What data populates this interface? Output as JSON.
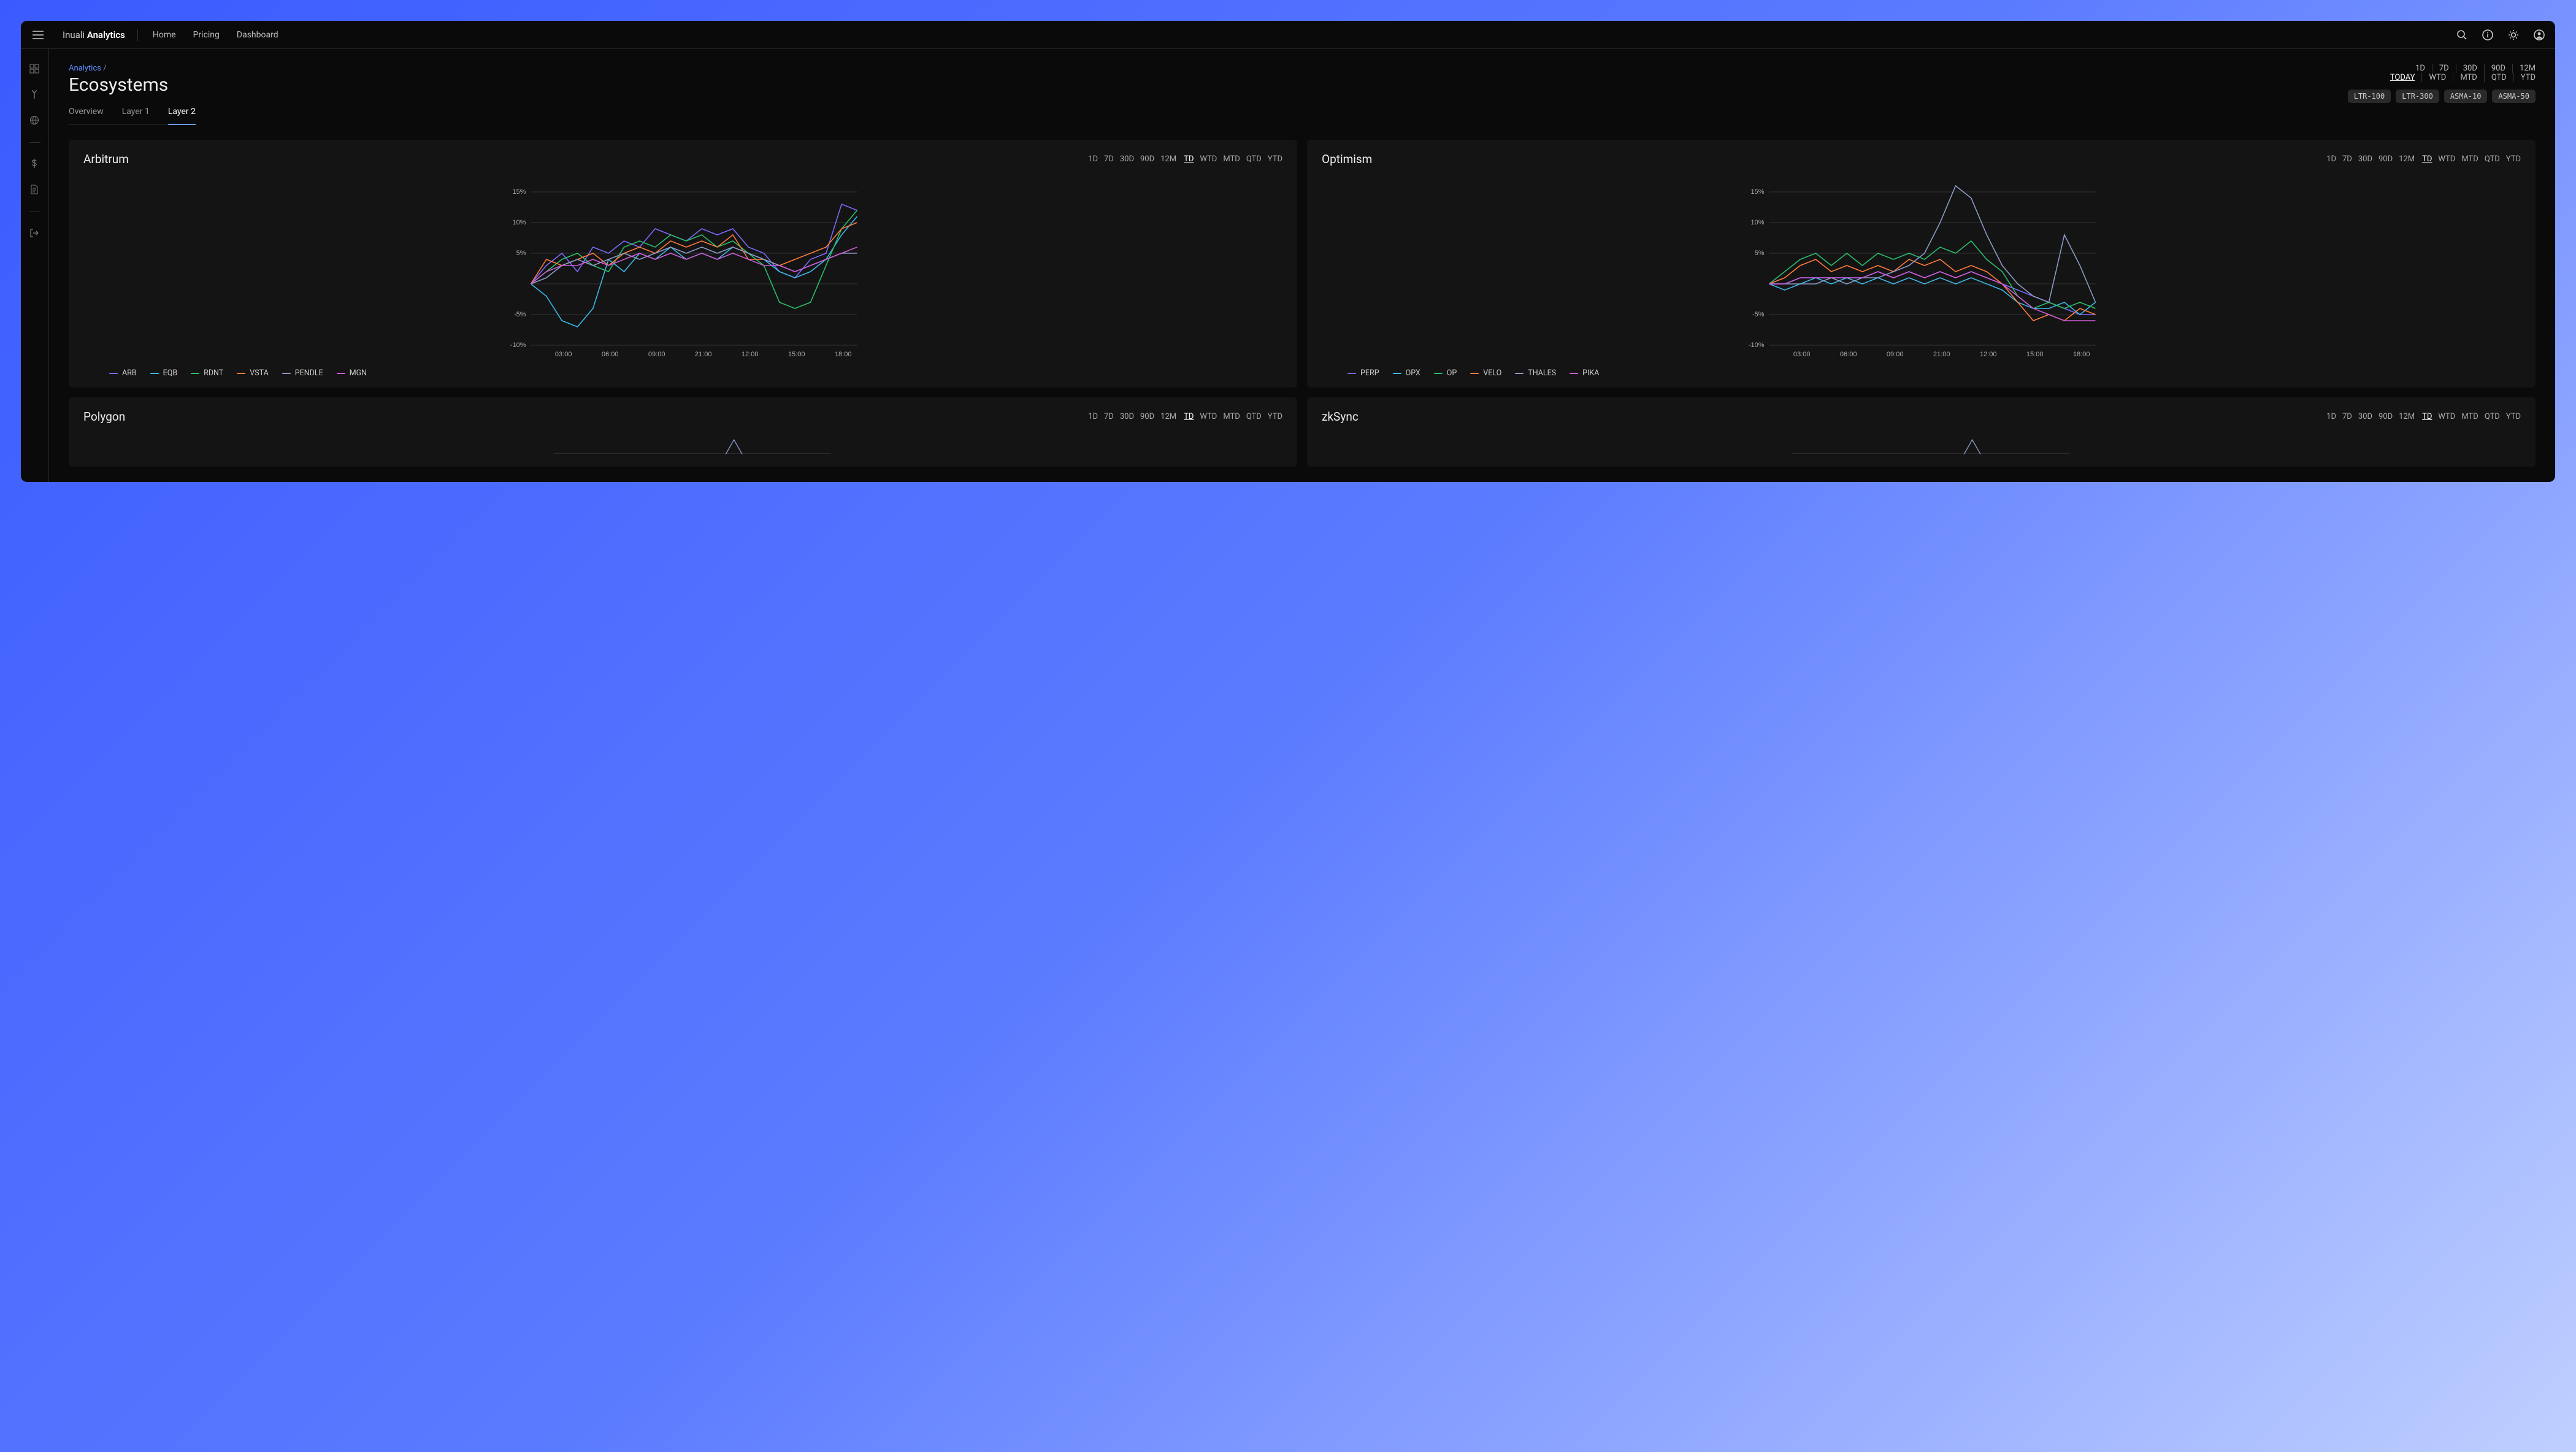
{
  "brand": {
    "pre": "Inuali ",
    "strong": "Analytics"
  },
  "topnav": [
    {
      "label": "Home"
    },
    {
      "label": "Pricing"
    },
    {
      "label": "Dashboard"
    }
  ],
  "breadcrumb": {
    "link": "Analytics",
    "sep": " /"
  },
  "page_title": "Ecosystems",
  "tabs": [
    {
      "label": "Overview"
    },
    {
      "label": "Layer 1"
    },
    {
      "label": "Layer 2",
      "active": true
    }
  ],
  "range_top": [
    "1D",
    "7D",
    "30D",
    "90D",
    "12M"
  ],
  "range_bottom": [
    {
      "label": "TODAY",
      "active": true
    },
    {
      "label": "WTD"
    },
    {
      "label": "MTD"
    },
    {
      "label": "QTD"
    },
    {
      "label": "YTD"
    }
  ],
  "chips": [
    "LTR-100",
    "LTR-300",
    "ASMA-10",
    "ASMA-50"
  ],
  "card_ranges_a": [
    "1D",
    "7D",
    "30D",
    "90D",
    "12M"
  ],
  "card_ranges_b": [
    {
      "label": "TD",
      "active": true
    },
    {
      "label": "WTD"
    },
    {
      "label": "MTD"
    },
    {
      "label": "QTD"
    },
    {
      "label": "YTD"
    }
  ],
  "colors": {
    "purple": "#7b6bff",
    "cyan": "#3bb8e8",
    "green": "#2bbf6b",
    "orange": "#ff7b3b",
    "slate": "#8b9bc8",
    "magenta": "#cf5bd8"
  },
  "chart_meta": {
    "y_ticks": [
      15,
      10,
      5,
      0,
      -5,
      -10
    ],
    "y_labels": [
      "15%",
      "10%",
      "5%",
      "",
      "-5%",
      "-10%"
    ],
    "x_labels": [
      "03:00",
      "06:00",
      "09:00",
      "21:00",
      "12:00",
      "15:00",
      "18:00"
    ],
    "ylim": [
      -10,
      17
    ]
  },
  "chart_data": [
    {
      "title": "Arbitrum",
      "type": "line",
      "x": [
        0,
        1,
        2,
        3,
        4,
        5,
        6,
        7,
        8,
        9,
        10,
        11,
        12,
        13,
        14,
        15,
        16,
        17,
        18,
        19,
        20,
        21
      ],
      "series": [
        {
          "name": "ARB",
          "color": "purple",
          "values": [
            0,
            3,
            5,
            2,
            6,
            5,
            7,
            6,
            9,
            8,
            7,
            9,
            8,
            9,
            6,
            5,
            2,
            1,
            4,
            5,
            13,
            12
          ]
        },
        {
          "name": "EQB",
          "color": "cyan",
          "values": [
            0,
            -2,
            -6,
            -7,
            -4,
            4,
            2,
            5,
            4,
            6,
            4,
            5,
            4,
            6,
            5,
            4,
            2,
            1,
            2,
            4,
            8,
            11
          ]
        },
        {
          "name": "RDNT",
          "color": "green",
          "values": [
            0,
            2,
            4,
            5,
            3,
            2,
            6,
            7,
            6,
            8,
            7,
            8,
            6,
            7,
            5,
            3,
            -3,
            -4,
            -3,
            3,
            9,
            12
          ]
        },
        {
          "name": "VSTA",
          "color": "orange",
          "values": [
            0,
            4,
            3,
            4,
            5,
            3,
            5,
            6,
            5,
            7,
            6,
            7,
            6,
            8,
            4,
            4,
            3,
            4,
            5,
            6,
            9,
            10
          ]
        },
        {
          "name": "PENDLE",
          "color": "slate",
          "values": [
            0,
            1,
            3,
            4,
            3,
            4,
            5,
            4,
            5,
            6,
            5,
            6,
            5,
            6,
            5,
            4,
            3,
            2,
            3,
            4,
            5,
            5
          ]
        },
        {
          "name": "MGN",
          "color": "magenta",
          "values": [
            0,
            2,
            3,
            3,
            4,
            3,
            4,
            5,
            4,
            5,
            4,
            5,
            4,
            5,
            4,
            3,
            3,
            2,
            3,
            4,
            5,
            6
          ]
        }
      ]
    },
    {
      "title": "Optimism",
      "type": "line",
      "x": [
        0,
        1,
        2,
        3,
        4,
        5,
        6,
        7,
        8,
        9,
        10,
        11,
        12,
        13,
        14,
        15,
        16,
        17,
        18,
        19,
        20,
        21
      ],
      "series": [
        {
          "name": "PERP",
          "color": "purple",
          "values": [
            0,
            0,
            1,
            1,
            1,
            1,
            1,
            2,
            1,
            2,
            1,
            2,
            1,
            2,
            1,
            0,
            -1,
            -2,
            -3,
            -4,
            -5,
            -5
          ]
        },
        {
          "name": "OPX",
          "color": "cyan",
          "values": [
            0,
            -1,
            0,
            1,
            0,
            1,
            0,
            1,
            0,
            1,
            0,
            1,
            0,
            1,
            0,
            -1,
            -3,
            -4,
            -4,
            -3,
            -5,
            -3
          ]
        },
        {
          "name": "OP",
          "color": "green",
          "values": [
            0,
            2,
            4,
            5,
            3,
            5,
            3,
            5,
            4,
            5,
            4,
            6,
            5,
            7,
            4,
            2,
            -2,
            -4,
            -3,
            -4,
            -3,
            -4
          ]
        },
        {
          "name": "VELO",
          "color": "orange",
          "values": [
            0,
            1,
            3,
            4,
            2,
            3,
            2,
            3,
            2,
            4,
            3,
            4,
            2,
            3,
            2,
            0,
            -3,
            -6,
            -5,
            -6,
            -4,
            -5
          ]
        },
        {
          "name": "THALES",
          "color": "slate",
          "values": [
            0,
            0,
            0,
            0,
            1,
            0,
            1,
            1,
            2,
            3,
            5,
            10,
            16,
            14,
            8,
            3,
            0,
            -2,
            -3,
            8,
            3,
            -3
          ]
        },
        {
          "name": "PIKA",
          "color": "magenta",
          "values": [
            0,
            0,
            1,
            1,
            1,
            1,
            1,
            2,
            1,
            2,
            1,
            2,
            1,
            2,
            1,
            0,
            -2,
            -4,
            -5,
            -6,
            -6,
            -6
          ]
        }
      ]
    },
    {
      "title": "Polygon",
      "type": "line",
      "partial": true
    },
    {
      "title": "zkSync",
      "type": "line",
      "partial": true
    }
  ]
}
